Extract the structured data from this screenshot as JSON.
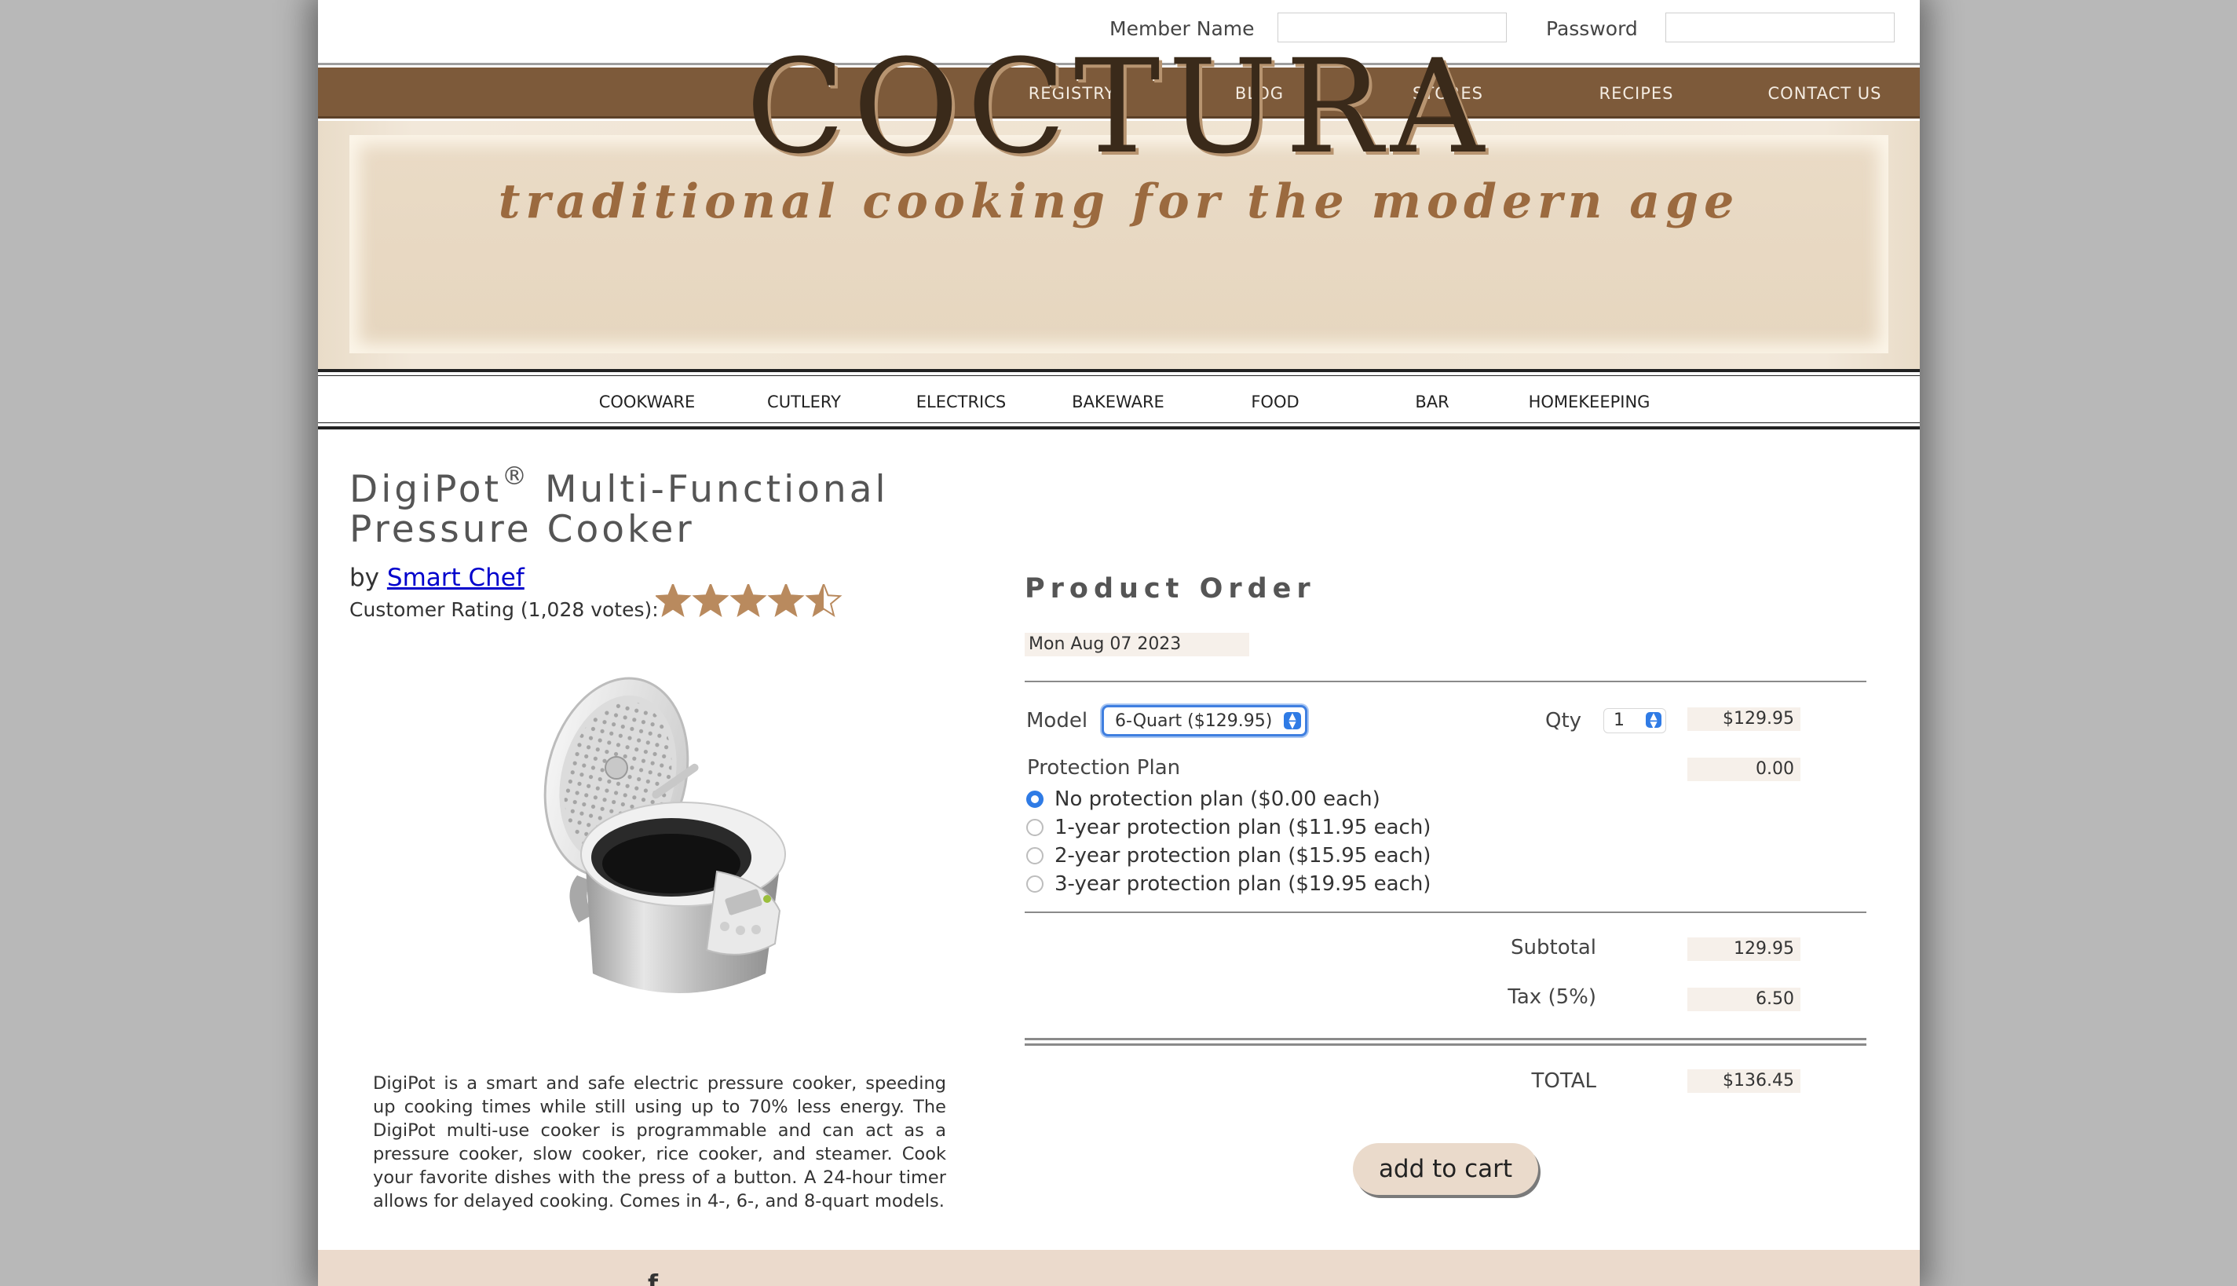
{
  "login": {
    "member_label": "Member Name",
    "member_value": "",
    "password_label": "Password",
    "password_value": ""
  },
  "top_nav": [
    "REGISTRY",
    "BLOG",
    "STORES",
    "RECIPES",
    "CONTACT US"
  ],
  "banner": {
    "brand": "COCTURA",
    "tagline": "traditional cooking for the modern age"
  },
  "category_nav": [
    "COOKWARE",
    "CUTLERY",
    "ELECTRICS",
    "BAKEWARE",
    "FOOD",
    "BAR",
    "HOMEKEEPING"
  ],
  "product": {
    "title_part1": "DigiPot",
    "registered_mark": "®",
    "title_part2": " Multi-Functional",
    "title_line2": "Pressure Cooker",
    "by_prefix": "by ",
    "brand_link": "Smart Chef",
    "rating_text": "Customer Rating (1,028 votes):",
    "rating_value": 4.5,
    "rating_max": 5,
    "description": "DigiPot is a smart and safe electric pressure cooker, speeding up cooking times while still using up to 70% less energy. The DigiPot multi-use cooker is programmable and can act as a pressure cooker, slow cooker, rice cooker, and steamer. Cook your favorite dishes with the press of a button. A 24-hour timer allows for delayed cooking. Comes in 4-, 6-, and 8-quart models."
  },
  "order": {
    "heading": "Product Order",
    "date": "Mon Aug 07 2023",
    "model_label": "Model",
    "model_selected": "6-Quart ($129.95)",
    "qty_label": "Qty",
    "qty_selected": "1",
    "model_price": "$129.95",
    "protection_label": "Protection Plan",
    "protection_price": "0.00",
    "protection_options": [
      {
        "label": "No protection plan ($0.00 each)",
        "checked": true
      },
      {
        "label": "1-year protection plan ($11.95 each)",
        "checked": false
      },
      {
        "label": "2-year protection plan ($15.95 each)",
        "checked": false
      },
      {
        "label": "3-year protection plan ($19.95 each)",
        "checked": false
      }
    ],
    "subtotal_label": "Subtotal",
    "subtotal": "129.95",
    "tax_label": "Tax (5%)",
    "tax": "6.50",
    "total_label": "TOTAL",
    "total": "$136.45",
    "add_to_cart": "add to cart"
  },
  "footer": {
    "facebook_icon_glyph": "f"
  },
  "colors": {
    "nav_brown": "#7d5a3a",
    "banner_beige": "#eadbc6",
    "star_tan": "#b98a5e",
    "footer_beige": "#ebdacc",
    "select_blue": "#2f7be5"
  }
}
